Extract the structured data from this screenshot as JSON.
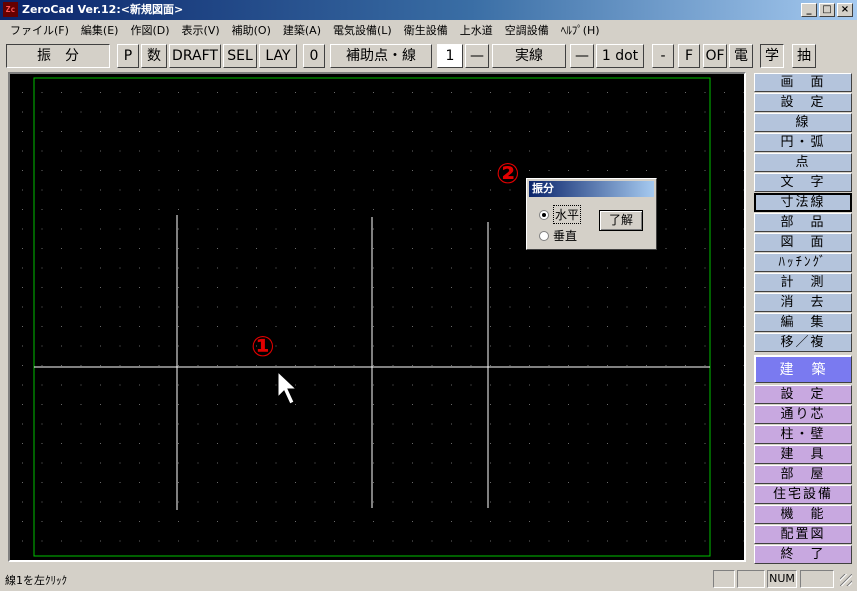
{
  "window": {
    "title": "ZeroCad Ver.12:<新規図面>",
    "icon": "zerocad-app-icon",
    "icon_text": "Zc",
    "controls": {
      "minimize": "_",
      "maximize": "□",
      "close": "×"
    }
  },
  "menu": [
    "ファイル(F)",
    "編集(E)",
    "作図(D)",
    "表示(V)",
    "補助(O)",
    "建築(A)",
    "電気設備(L)",
    "衛生設備",
    "上水道",
    "空調設備",
    "ﾍﾙﾌﾟ(H)"
  ],
  "toolbar": {
    "mode": "振　分",
    "p": "P",
    "num": "数",
    "draft": "DRAFT",
    "sel": "SEL",
    "lay": "LAY",
    "zero": "0",
    "aux": "補助点・線",
    "layer_num": "1",
    "line_style_icon": "—",
    "line_type": "実線",
    "width_icon": "—",
    "width": "1 dot",
    "minus": "-",
    "f": "F",
    "of": "OF",
    "den": "電",
    "gaku": "学",
    "chu": "抽"
  },
  "sidebar": {
    "top": [
      "画　面",
      "設　定",
      "線",
      "円・弧",
      "点",
      "文　字",
      "寸法線",
      "部　品",
      "図　面",
      "ﾊｯﾁﾝｸﾞ",
      "計　測",
      "消　去",
      "編　集",
      "移／複"
    ],
    "section": "建　築",
    "bottom": [
      "設　定",
      "通り芯",
      "柱・壁",
      "建　具",
      "部　屋",
      "住宅設備",
      "機　能",
      "配置図",
      "終　了"
    ]
  },
  "dialog": {
    "title": "振分",
    "options": [
      "水平",
      "垂直"
    ],
    "selected": "水平",
    "ok": "了解"
  },
  "markers": {
    "one": "①",
    "two": "②"
  },
  "status": {
    "message": "線1を左ｸﾘｯｸ",
    "num": "NUM"
  },
  "colors": {
    "canvas_bg": "#000000",
    "border_line": "#00c000",
    "drawn_line": "#ffffff",
    "marker": "#e00000",
    "sidebar_blue": "#b4c4dc",
    "sidebar_purple": "#c8a8e0"
  }
}
